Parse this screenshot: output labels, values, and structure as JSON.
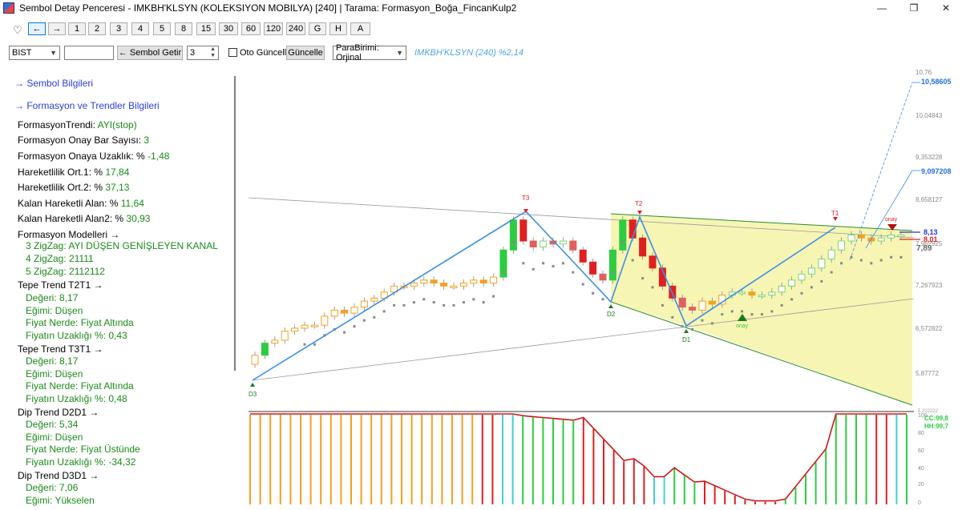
{
  "window": {
    "title": "Sembol Detay Penceresi - IMKBH'KLSYN (KOLEKSIYON MOBILYA) [240] | Tarama: Formasyon_Boğa_FincanKulp2",
    "minimize": "—",
    "restore": "❐",
    "close": "✕"
  },
  "toolbar1": {
    "heart": "♡",
    "buttons": [
      "←",
      "→",
      "1",
      "2",
      "3",
      "4",
      "5",
      "8",
      "15",
      "30",
      "60",
      "120",
      "240",
      "G",
      "H",
      "A"
    ]
  },
  "toolbar2": {
    "exchange": "BIST",
    "symbol_input": "",
    "fetch_button": "← Sembol Getir",
    "count": "3",
    "auto_update_label": "Oto Güncelle",
    "update_button": "Güncelle",
    "currency": "ParaBirimi: Orjinal",
    "symbol_info": "IMKBH'KLSYN (240)  %2,14"
  },
  "panel": {
    "symbol_info_link": "→ Sembol Bilgileri",
    "formation_link": "→ Formasyon ve Trendler Bilgileri",
    "rows": [
      {
        "label": "FormasyonTrendi:",
        "value": "AYI(stop)"
      },
      {
        "label": "Formasyon Onay Bar Sayısı:",
        "value": "3"
      },
      {
        "label": "Formasyon Onaya Uzaklık: %",
        "value": "-1,48"
      },
      {
        "label": "Hareketlilik Ort.1: %",
        "value": "17,84"
      },
      {
        "label": "Hareketlilik Ort.2: %",
        "value": "37,13"
      },
      {
        "label": "Kalan Hareketli Alan: %",
        "value": "11,64"
      },
      {
        "label": "Kalan Hareketli Alan2: %",
        "value": "30,93"
      }
    ],
    "models_title": "Formasyon Modelleri →",
    "models": [
      "3 ZigZag: AYI DÜŞEN GENİŞLEYEN KANAL",
      "4 ZigZag: 21111",
      "5 ZigZag: 2112112"
    ],
    "t2t1_title": "Tepe Trend T2T1 →",
    "t2t1": [
      "Değeri: 8,17",
      "Eğimi: Düşen",
      "Fiyat Nerde: Fiyat Altında",
      "Fiyatın Uzaklığı %: 0,43"
    ],
    "t3t1_title": "Tepe Trend T3T1 →",
    "t3t1": [
      "Değeri: 8,17",
      "Eğimi: Düşen",
      "Fiyat Nerde: Fiyat Altında",
      "Fiyatın Uzaklığı %: 0,48"
    ],
    "d2d1_title": "Dip Trend D2D1 →",
    "d2d1": [
      "Değeri: 5,34",
      "Eğimi: Düşen",
      "Fiyat Nerde: Fiyat Üstünde",
      "Fiyatın Uzaklığı %: -34,32"
    ],
    "d3d1_title": "Dip Trend D3D1 →",
    "d3d1": [
      "Değeri: 7,06",
      "Eğimi: Yükselen"
    ]
  },
  "chart": {
    "y_ticks": [
      "10,76",
      "10,04843",
      "9,353228",
      "8,658127",
      "7,962925",
      "7,267923",
      "6,572822",
      "5,87772"
    ],
    "price_labels": {
      "target1": "10,58605",
      "target2": "9,097208",
      "blue": "8,13",
      "red": "8,01",
      "last": "7,89"
    },
    "pivot_labels": {
      "t3": "T3",
      "t2": "T2",
      "t1": "T1",
      "d3": "D3",
      "d2": "D2",
      "d1": "D1",
      "onay_top": "onay",
      "onay_bottom": "onay"
    },
    "osc_ticks": [
      "100",
      "80",
      "60",
      "40",
      "20",
      "0"
    ],
    "osc_top_label": "5,222222",
    "osc_labels": {
      "cc": "CC:99,8",
      "hh": "HH:99,7"
    },
    "colors": {
      "zigzag": "#3c8ee6",
      "up": "#2ecc40",
      "down": "#e02020",
      "neutral": "#f5a020",
      "cyan": "#40d0d0",
      "channel": "#f6f5b4"
    }
  },
  "chart_data": {
    "type": "candlestick",
    "title": "IMKBH'KLSYN (240)",
    "pivots": [
      {
        "label": "D3",
        "value": 5.8
      },
      {
        "label": "T3",
        "value": 8.45
      },
      {
        "label": "D2",
        "value": 7.1
      },
      {
        "label": "T2",
        "value": 8.4
      },
      {
        "label": "D1",
        "value": 6.55
      },
      {
        "label": "T1",
        "value": 8.4
      }
    ],
    "closes": [
      6.05,
      6.25,
      6.3,
      6.45,
      6.5,
      6.55,
      6.55,
      6.7,
      6.8,
      6.75,
      6.85,
      6.95,
      7.0,
      7.1,
      7.2,
      7.2,
      7.25,
      7.3,
      7.25,
      7.2,
      7.2,
      7.25,
      7.3,
      7.25,
      7.35,
      7.8,
      8.3,
      7.95,
      7.85,
      7.95,
      7.9,
      7.95,
      7.8,
      7.6,
      7.4,
      7.3,
      7.8,
      8.3,
      8.0,
      7.7,
      7.5,
      7.2,
      7.0,
      6.85,
      6.8,
      6.95,
      6.9,
      7.05,
      7.1,
      7.1,
      7.05,
      7.05,
      7.1,
      7.2,
      7.3,
      7.4,
      7.5,
      7.65,
      7.8,
      7.95,
      8.05,
      8.0,
      7.95,
      8.0,
      8.05,
      8.05
    ],
    "targets": [
      10.58605,
      9.097208
    ],
    "levels": {
      "blue": 8.13,
      "red": 8.01,
      "last": 7.89
    },
    "y_range": [
      5.5,
      10.76
    ],
    "oscillator": {
      "ticks": [
        0,
        20,
        40,
        60,
        80,
        100
      ],
      "cc": 99.8,
      "hh": 99.7
    }
  }
}
